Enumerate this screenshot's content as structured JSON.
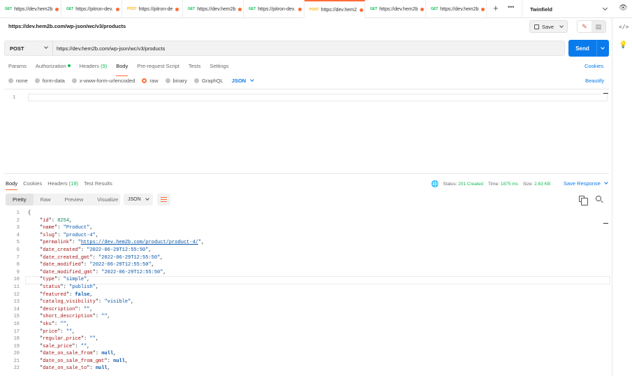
{
  "tabs": [
    {
      "method": "GET",
      "label": "https://dev.hem2b",
      "unsaved": true
    },
    {
      "method": "GET",
      "label": "https://pitron-dev.",
      "unsaved": true
    },
    {
      "method": "POST",
      "label": "https://pitron-de",
      "unsaved": true
    },
    {
      "method": "GET",
      "label": "https://dev.hem2b",
      "unsaved": true
    },
    {
      "method": "GET",
      "label": "https://pitron-dev.",
      "unsaved": true
    },
    {
      "method": "POST",
      "label": "https://dev.hem2",
      "unsaved": true,
      "active": true
    },
    {
      "method": "GET",
      "label": "https://dev.hem2b",
      "unsaved": true
    },
    {
      "method": "GET",
      "label": "https://dev.hem2b",
      "unsaved": true
    }
  ],
  "environment": "Twinfield",
  "request": {
    "title": "https://dev.hem2b.com/wp-json/wc/v3/products",
    "save_label": "Save",
    "method": "POST",
    "url": "https://dev.hem2b.com/wp-json/wc/v3/products",
    "send_label": "Send",
    "tabs": {
      "params": "Params",
      "authorization": "Authorization",
      "headers": "Headers",
      "headers_count": "(9)",
      "body": "Body",
      "prerequest": "Pre-request Script",
      "tests": "Tests",
      "settings": "Settings"
    },
    "cookies_link": "Cookies",
    "body_types": [
      "none",
      "form-data",
      "x-www-form-urlencoded",
      "raw",
      "binary",
      "GraphQL"
    ],
    "selected_body_type": "raw",
    "body_format": "JSON",
    "beautify_link": "Beautify",
    "editor_line": "1"
  },
  "response": {
    "tabs": {
      "body": "Body",
      "cookies": "Cookies",
      "headers": "Headers",
      "headers_count": "(19)",
      "test_results": "Test Results"
    },
    "status_label": "Status:",
    "status_value": "201 Created",
    "time_label": "Time:",
    "time_value": "1875 ms",
    "size_label": "Size:",
    "size_value": "2.63 KB",
    "save_response": "Save Response",
    "view_modes": [
      "Pretty",
      "Raw",
      "Preview",
      "Visualize"
    ],
    "active_view": "Pretty",
    "format": "JSON",
    "lines": [
      {
        "n": "1",
        "text": "{"
      },
      {
        "n": "2",
        "key": "id",
        "num": "8254"
      },
      {
        "n": "3",
        "key": "name",
        "str": "Product"
      },
      {
        "n": "4",
        "key": "slug",
        "str": "product-4"
      },
      {
        "n": "5",
        "key": "permalink",
        "url": "https://dev.hem2b.com/product/product-4/"
      },
      {
        "n": "6",
        "key": "date_created",
        "str": "2022-06-29T12:55:50"
      },
      {
        "n": "7",
        "key": "date_created_gmt",
        "str": "2022-06-29T12:55:50"
      },
      {
        "n": "8",
        "key": "date_modified",
        "str": "2022-06-29T12:55:50"
      },
      {
        "n": "9",
        "key": "date_modified_gmt",
        "str": "2022-06-29T12:55:50"
      },
      {
        "n": "10",
        "key": "type",
        "str": "simple"
      },
      {
        "n": "11",
        "key": "status",
        "str": "publish"
      },
      {
        "n": "12",
        "key": "featured",
        "lit": "false"
      },
      {
        "n": "13",
        "key": "catalog_visibility",
        "str": "visible"
      },
      {
        "n": "14",
        "key": "description",
        "str": ""
      },
      {
        "n": "15",
        "key": "short_description",
        "str": ""
      },
      {
        "n": "16",
        "key": "sku",
        "str": ""
      },
      {
        "n": "17",
        "key": "price",
        "str": ""
      },
      {
        "n": "18",
        "key": "regular_price",
        "str": ""
      },
      {
        "n": "19",
        "key": "sale_price",
        "str": ""
      },
      {
        "n": "20",
        "key": "date_on_sale_from",
        "lit": "null"
      },
      {
        "n": "21",
        "key": "date_on_sale_from_gmt",
        "lit": "null"
      },
      {
        "n": "22",
        "key": "date_on_sale_to",
        "lit": "null"
      }
    ]
  },
  "colors": {
    "accent": "#ff6c37",
    "send": "#097bed",
    "get": "#0cbb52",
    "post": "#ffb400"
  }
}
